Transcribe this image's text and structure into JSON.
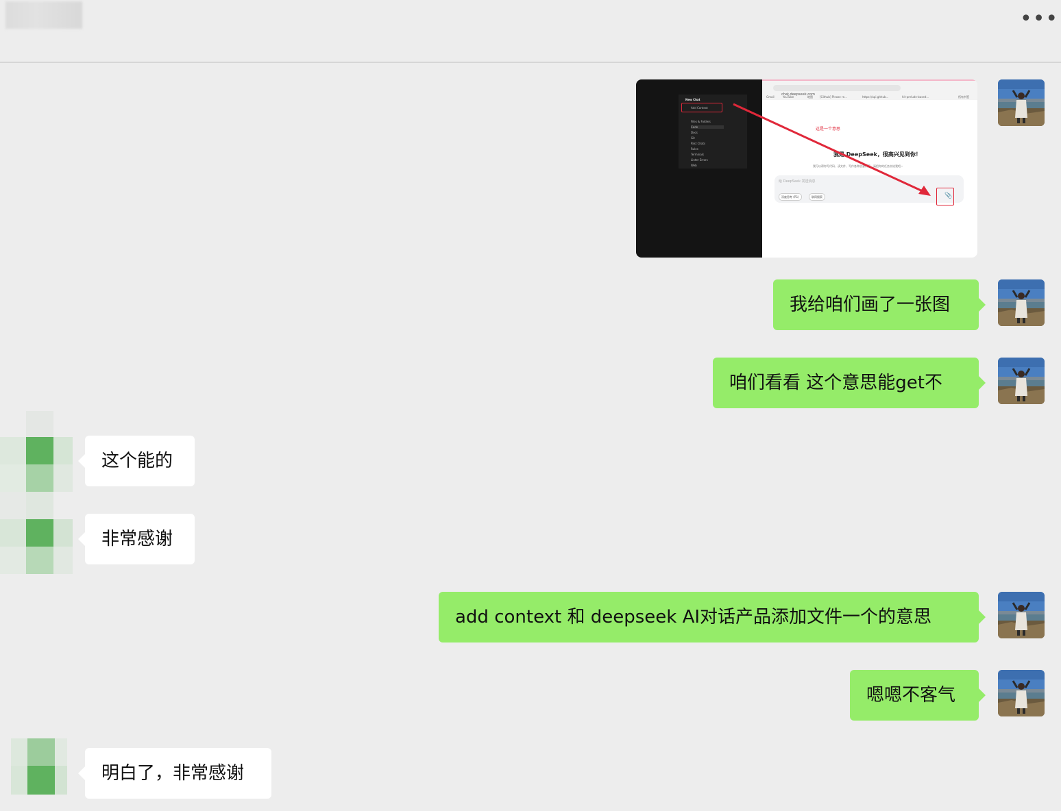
{
  "header": {
    "more_label": "•••"
  },
  "screenshot": {
    "left_panel_title": "New Chat",
    "left_panel_items": [
      "Add Context",
      "Files & Folders",
      "Code",
      "Docs",
      "Git",
      "Past Chats",
      "Rules",
      "Terminals",
      "Linter Errors",
      "Web"
    ],
    "url": "chat.deepseek.com",
    "bookmarks": [
      "Gmail",
      "YouTube",
      "地图",
      "[Github] Please re...",
      "https://api.github...",
      "hit-prelude-based..."
    ],
    "bookmarks_right": "所有书签",
    "annotation_note": "这是一个意思",
    "greeting": "我是 DeepSeek，很高兴见到你！",
    "greeting_sub": "我可以帮你写代码、读文件、写作各种创意内容，请把你的任务交给我吧~",
    "input_placeholder": "给 DeepSeek 发送消息",
    "pill_deep_think": "深度思考 (R1)",
    "pill_web_search": "联网搜索"
  },
  "messages": [
    {
      "id": "m1",
      "side": "out",
      "text": "我给咱们画了一张图"
    },
    {
      "id": "m2",
      "side": "out",
      "text": "咱们看看 这个意思能get不"
    },
    {
      "id": "m3",
      "side": "in",
      "text": "这个能的"
    },
    {
      "id": "m4",
      "side": "in",
      "text": "非常感谢"
    },
    {
      "id": "m5",
      "side": "out",
      "text": "add context 和  deepseek AI对话产品添加文件一个的意思"
    },
    {
      "id": "m6",
      "side": "out",
      "text": "嗯嗯不客气"
    },
    {
      "id": "m7",
      "side": "in",
      "text": "明白了，非常感谢"
    }
  ],
  "colors": {
    "background": "#ededed",
    "outgoing_bubble": "#95ec69",
    "incoming_bubble": "#ffffff",
    "annotation_red": "#e0283a"
  }
}
